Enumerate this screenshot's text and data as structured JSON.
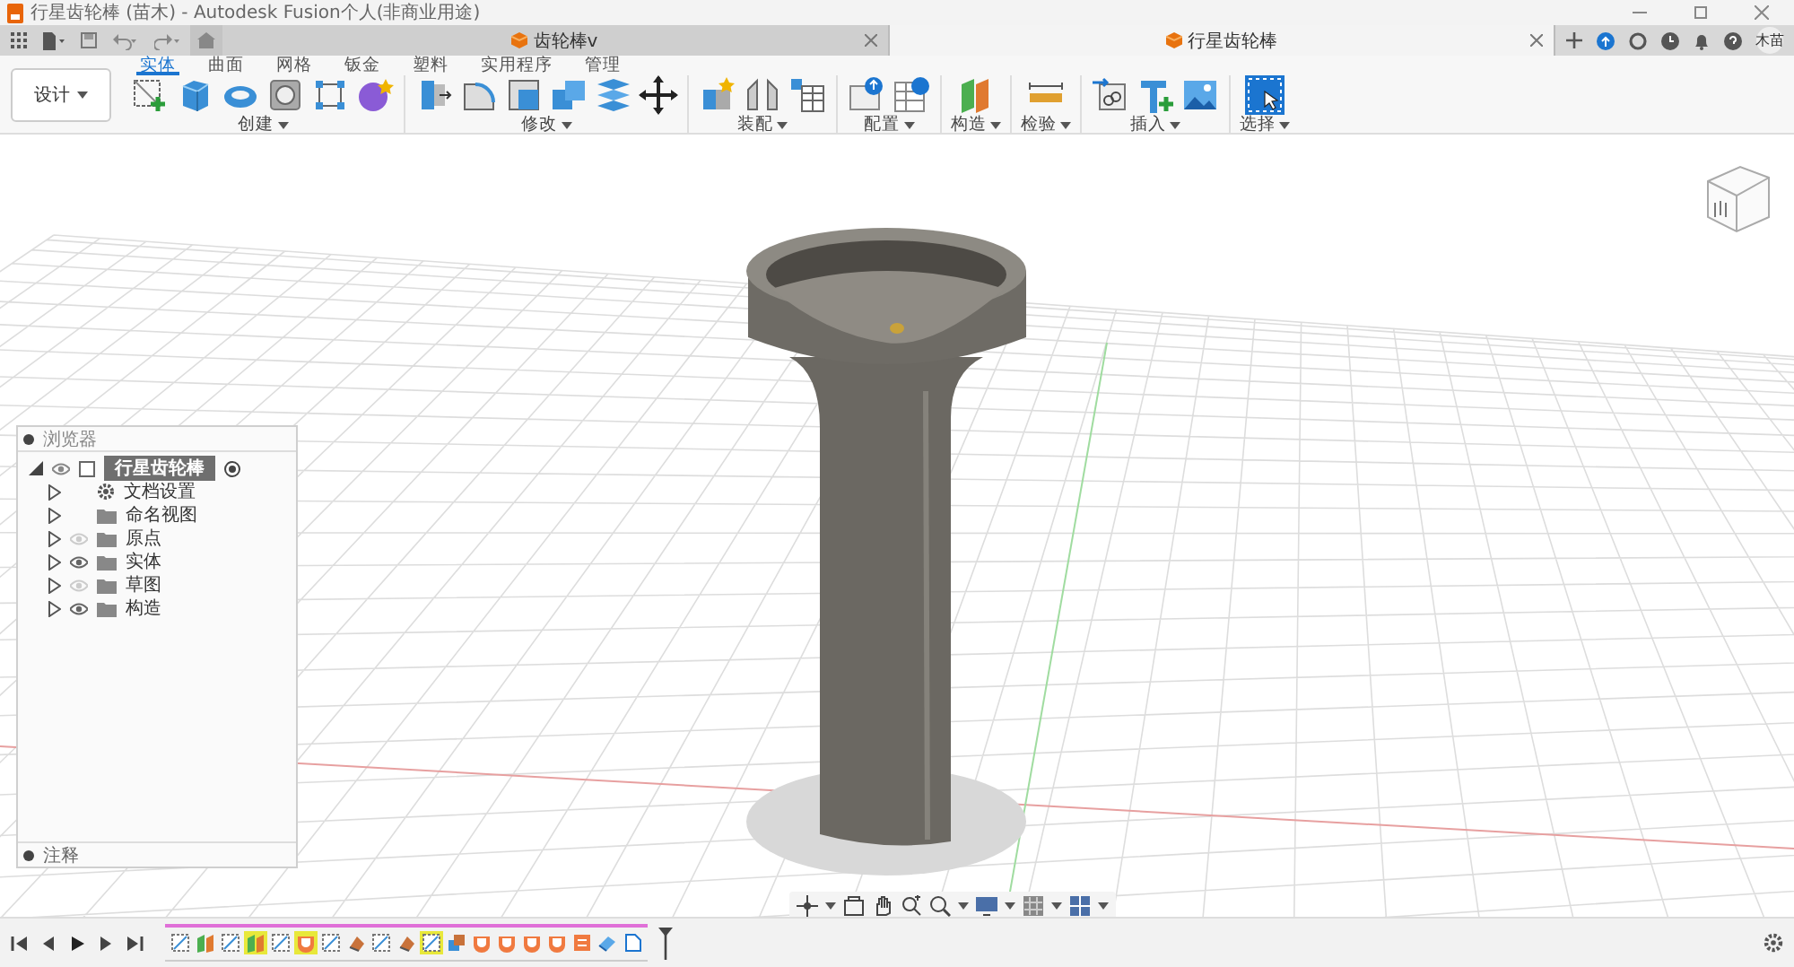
{
  "window": {
    "title": "行星齿轮棒 (苗木) - Autodesk Fusion个人(非商业用途)"
  },
  "document_tabs": [
    {
      "label": "齿轮棒v",
      "selected": false
    },
    {
      "label": "行星齿轮棒",
      "selected": true
    }
  ],
  "user": {
    "initials": "木苗"
  },
  "workspace": {
    "label": "设计"
  },
  "ribbon_tabs": [
    {
      "label": "实体",
      "selected": true
    },
    {
      "label": "曲面",
      "selected": false
    },
    {
      "label": "网格",
      "selected": false
    },
    {
      "label": "钣金",
      "selected": false
    },
    {
      "label": "塑料",
      "selected": false
    },
    {
      "label": "实用程序",
      "selected": false
    },
    {
      "label": "管理",
      "selected": false
    }
  ],
  "tool_groups": [
    {
      "label": "创建",
      "tools": [
        {
          "kind": "sketch"
        },
        {
          "kind": "box"
        },
        {
          "kind": "torus"
        },
        {
          "kind": "hole"
        },
        {
          "kind": "pattern"
        },
        {
          "kind": "form"
        }
      ]
    },
    {
      "label": "修改",
      "tools": [
        {
          "kind": "split"
        },
        {
          "kind": "fillet"
        },
        {
          "kind": "shell"
        },
        {
          "kind": "combine"
        },
        {
          "kind": "layers"
        },
        {
          "kind": "move"
        }
      ]
    },
    {
      "label": "装配",
      "tools": [
        {
          "kind": "component"
        },
        {
          "kind": "joint"
        },
        {
          "kind": "table"
        }
      ]
    },
    {
      "label": "配置",
      "tools": [
        {
          "kind": "config"
        },
        {
          "kind": "configtable"
        }
      ]
    },
    {
      "label": "构造",
      "tools": [
        {
          "kind": "plane"
        }
      ]
    },
    {
      "label": "检验",
      "tools": [
        {
          "kind": "measure"
        }
      ]
    },
    {
      "label": "插入",
      "tools": [
        {
          "kind": "derive"
        },
        {
          "kind": "insertplus"
        },
        {
          "kind": "image"
        }
      ]
    },
    {
      "label": "选择",
      "tools": [
        {
          "kind": "select"
        }
      ]
    }
  ],
  "browser": {
    "title": "浏览器",
    "root": {
      "label": "行星齿轮棒",
      "selected": true
    },
    "items": [
      {
        "label": "文档设置",
        "kind": "settings"
      },
      {
        "label": "命名视图",
        "kind": "views"
      },
      {
        "label": "原点",
        "kind": "folder",
        "visible": false
      },
      {
        "label": "实体",
        "kind": "folder",
        "visible": true
      },
      {
        "label": "草图",
        "kind": "folder",
        "visible": false
      },
      {
        "label": "构造",
        "kind": "folder",
        "visible": true
      }
    ]
  },
  "comments": {
    "label": "注释"
  },
  "timeline": {
    "features": [
      {
        "kind": "sketch",
        "highlighted": false
      },
      {
        "kind": "plane",
        "highlighted": false
      },
      {
        "kind": "sketch",
        "highlighted": false
      },
      {
        "kind": "plane",
        "highlighted": true
      },
      {
        "kind": "sketch",
        "highlighted": false
      },
      {
        "kind": "shell",
        "highlighted": true
      },
      {
        "kind": "sketch",
        "highlighted": false
      },
      {
        "kind": "revolve",
        "highlighted": false
      },
      {
        "kind": "sketch",
        "highlighted": false
      },
      {
        "kind": "revolve",
        "highlighted": false
      },
      {
        "kind": "sketch",
        "highlighted": true
      },
      {
        "kind": "combine",
        "highlighted": false
      },
      {
        "kind": "shell",
        "highlighted": false
      },
      {
        "kind": "shell",
        "highlighted": false
      },
      {
        "kind": "shell",
        "highlighted": false
      },
      {
        "kind": "shell",
        "highlighted": false
      },
      {
        "kind": "fillet",
        "highlighted": false
      },
      {
        "kind": "eraser",
        "highlighted": false
      },
      {
        "kind": "doc",
        "highlighted": false
      }
    ]
  }
}
